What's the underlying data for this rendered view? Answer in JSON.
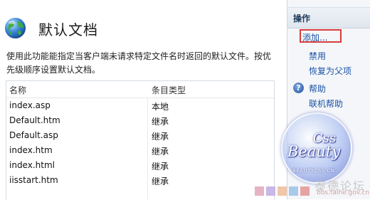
{
  "main": {
    "title": "默认文档",
    "title_icon": "globe-icon",
    "description": "使用此功能能指定当客户端未请求特定文件名时返回的默认文件。按优先级顺序设置默认文档。",
    "columns": [
      "名称",
      "条目类型"
    ],
    "rows": [
      {
        "name": "index.asp",
        "type": "本地"
      },
      {
        "name": "Default.htm",
        "type": "继承"
      },
      {
        "name": "Default.asp",
        "type": "继承"
      },
      {
        "name": "index.htm",
        "type": "继承"
      },
      {
        "name": "index.html",
        "type": "继承"
      },
      {
        "name": "iisstart.htm",
        "type": "继承"
      }
    ]
  },
  "actions": {
    "header": "操作",
    "add": "添加...",
    "disable": "禁用",
    "revert": "恢复为父项",
    "help_icon": "help-icon",
    "help": "帮助",
    "online_help": "联机帮助"
  },
  "watermark": {
    "line1": "Css",
    "line2": "Beauty",
    "url": "BEAUTYCSS.CN",
    "cn_text": "泰德论坛",
    "site": "bbs.taihe.gov.cn"
  },
  "colors": {
    "link": "#1a53a6",
    "highlight_box": "#d83c3c",
    "panel_bg": "#f4f6f9"
  }
}
